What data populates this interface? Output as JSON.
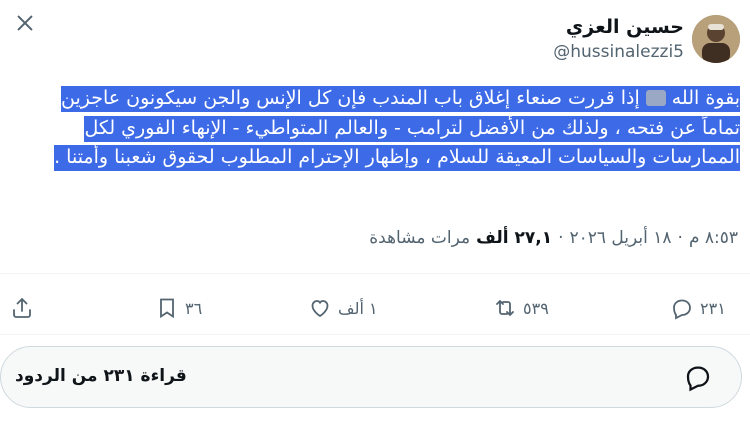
{
  "author": {
    "display_name": "حسين العزي",
    "handle": "@hussinalezzi5"
  },
  "tweet": {
    "text_part1": "بقوة الله",
    "text_part2": "إذا قررت صنعاء إغلاق باب المندب فإن كل الإنس والجن سيكونون عاجزين تماماً عن فتحه ، ولذلك من الأفضل لترامب - والعالم المتواطيء - الإنهاء الفوري لكل الممارسات والسياسات المعيقة للسلام ، وإظهار الإحترام المطلوب لحقوق شعبنا وأمتنا ."
  },
  "meta": {
    "time": "٨:٥٣ م",
    "date": "١٨ أبريل ٢٠٢٦",
    "views_count": "٢٧,١ ألف",
    "views_label": "مرات مشاهدة",
    "separator": "·"
  },
  "actions": {
    "replies": "٢٣١",
    "retweets": "٥٣٩",
    "likes": "١ ألف",
    "bookmarks": "٣٦"
  },
  "read_replies": {
    "label": "قراءة ٢٣١ من الردود"
  },
  "icons": [
    "close-icon",
    "reply-icon",
    "retweet-icon",
    "like-icon",
    "bookmark-icon",
    "share-icon",
    "replies-bubble-icon"
  ],
  "colors": {
    "selection": "#3d6be8",
    "muted": "#536471",
    "text": "#0f1419"
  }
}
